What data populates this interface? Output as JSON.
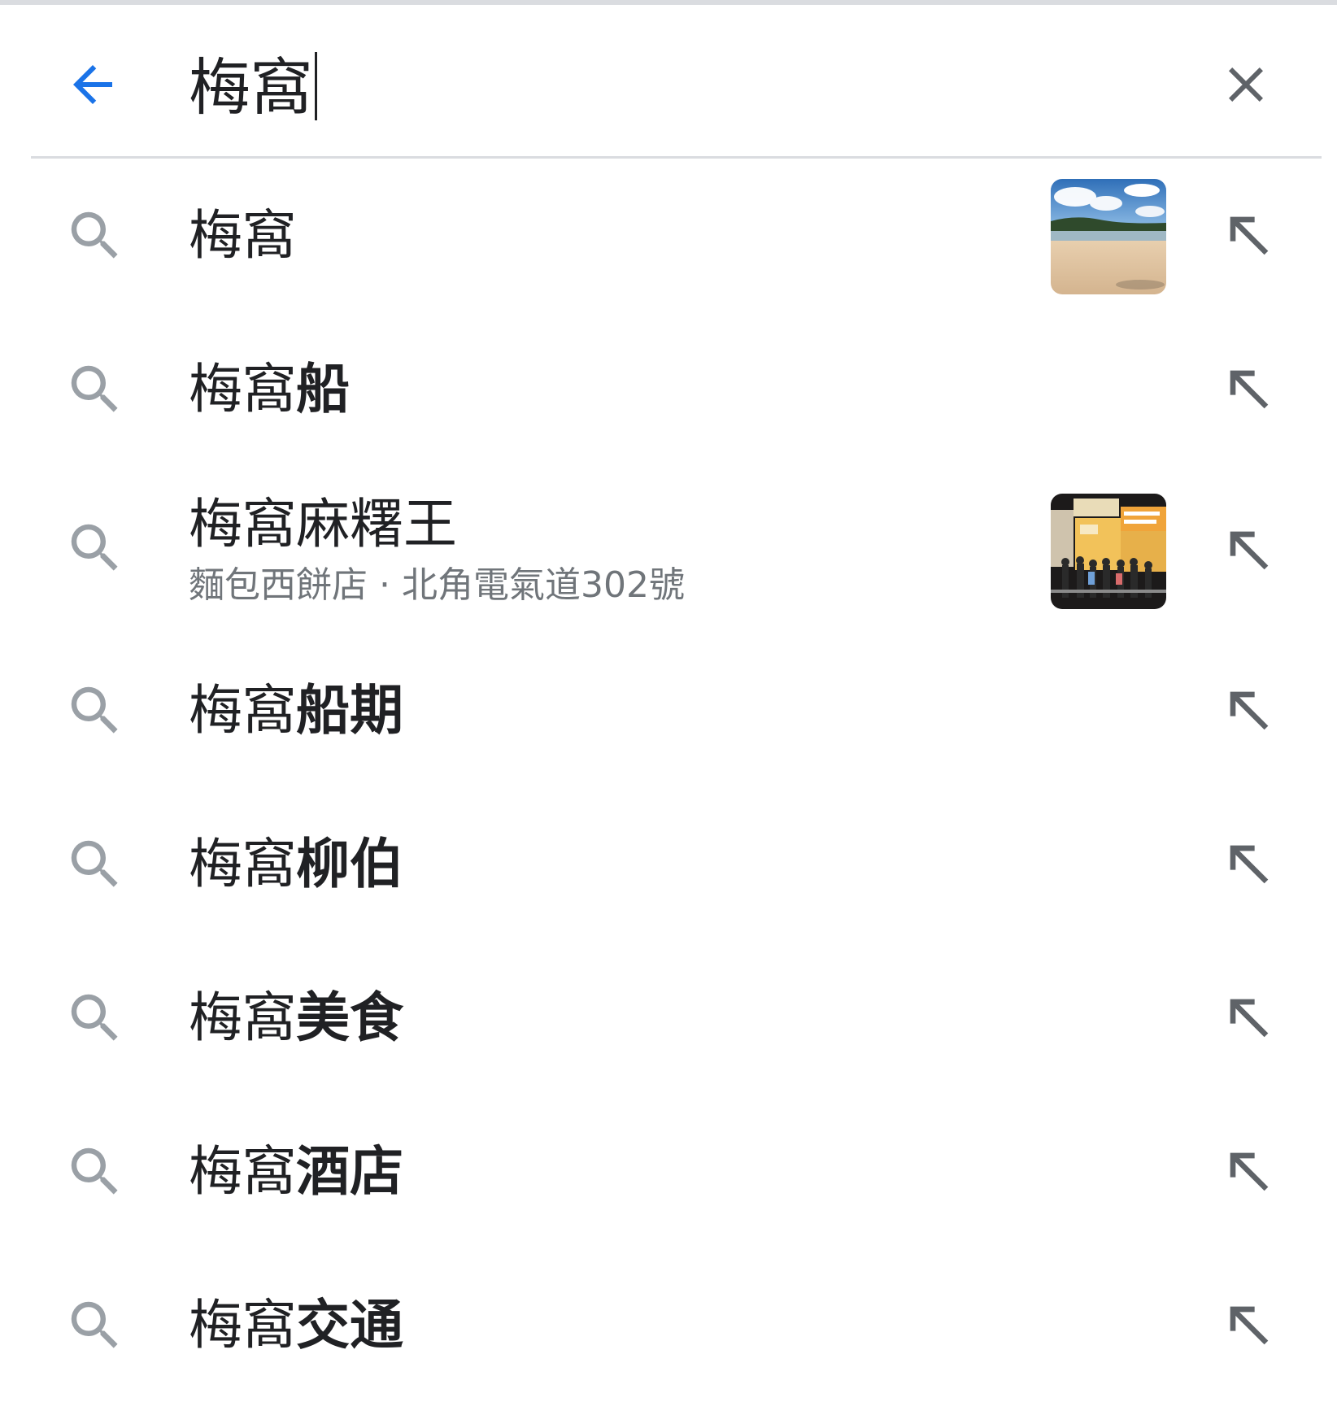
{
  "search": {
    "query": "梅窩",
    "back_icon": "arrow-back-icon",
    "clear_icon": "close-icon",
    "accent_color": "#1a73e8"
  },
  "suggestions": [
    {
      "prefix": "梅窩",
      "bold": "",
      "subtitle": "",
      "thumbnail": "beach-photo"
    },
    {
      "prefix": "梅窩",
      "bold": "船",
      "subtitle": "",
      "thumbnail": ""
    },
    {
      "prefix": "梅窩麻糬王",
      "bold": "",
      "subtitle": "麵包西餅店 · 北角電氣道302號",
      "thumbnail": "storefront-photo"
    },
    {
      "prefix": "梅窩",
      "bold": "船期",
      "subtitle": "",
      "thumbnail": ""
    },
    {
      "prefix": "梅窩",
      "bold": "柳伯",
      "subtitle": "",
      "thumbnail": ""
    },
    {
      "prefix": "梅窩",
      "bold": "美食",
      "subtitle": "",
      "thumbnail": ""
    },
    {
      "prefix": "梅窩",
      "bold": "酒店",
      "subtitle": "",
      "thumbnail": ""
    },
    {
      "prefix": "梅窩",
      "bold": "交通",
      "subtitle": "",
      "thumbnail": ""
    }
  ],
  "icons": {
    "row_search": "search-icon",
    "row_fill": "arrow-up-left-icon"
  },
  "colors": {
    "icon_gray": "#9aa0a6",
    "text": "#202124",
    "secondary_text": "#70757a",
    "divider": "#dadce0"
  }
}
